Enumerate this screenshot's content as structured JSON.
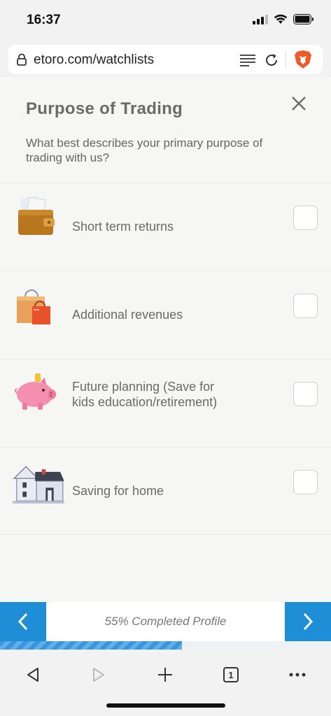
{
  "status": {
    "time": "16:37"
  },
  "browser": {
    "url": "etoro.com/watchlists",
    "tab_count": "1"
  },
  "modal": {
    "title": "Purpose of Trading",
    "subtitle": "What best describes your primary purpose of trading with us?",
    "options": [
      {
        "label": "Short term returns",
        "icon": "wallet-icon",
        "checked": false
      },
      {
        "label": "Additional revenues",
        "icon": "shopping-bags-icon",
        "checked": false
      },
      {
        "label": "Future planning (Save for kids education/retirement)",
        "icon": "piggy-bank-icon",
        "checked": false
      },
      {
        "label": "Saving for home",
        "icon": "house-icon",
        "checked": false
      }
    ]
  },
  "progress": {
    "text": "55% Completed Profile",
    "percent": 55
  },
  "colors": {
    "accent": "#1e8ed6",
    "brave": "#f05a28"
  }
}
